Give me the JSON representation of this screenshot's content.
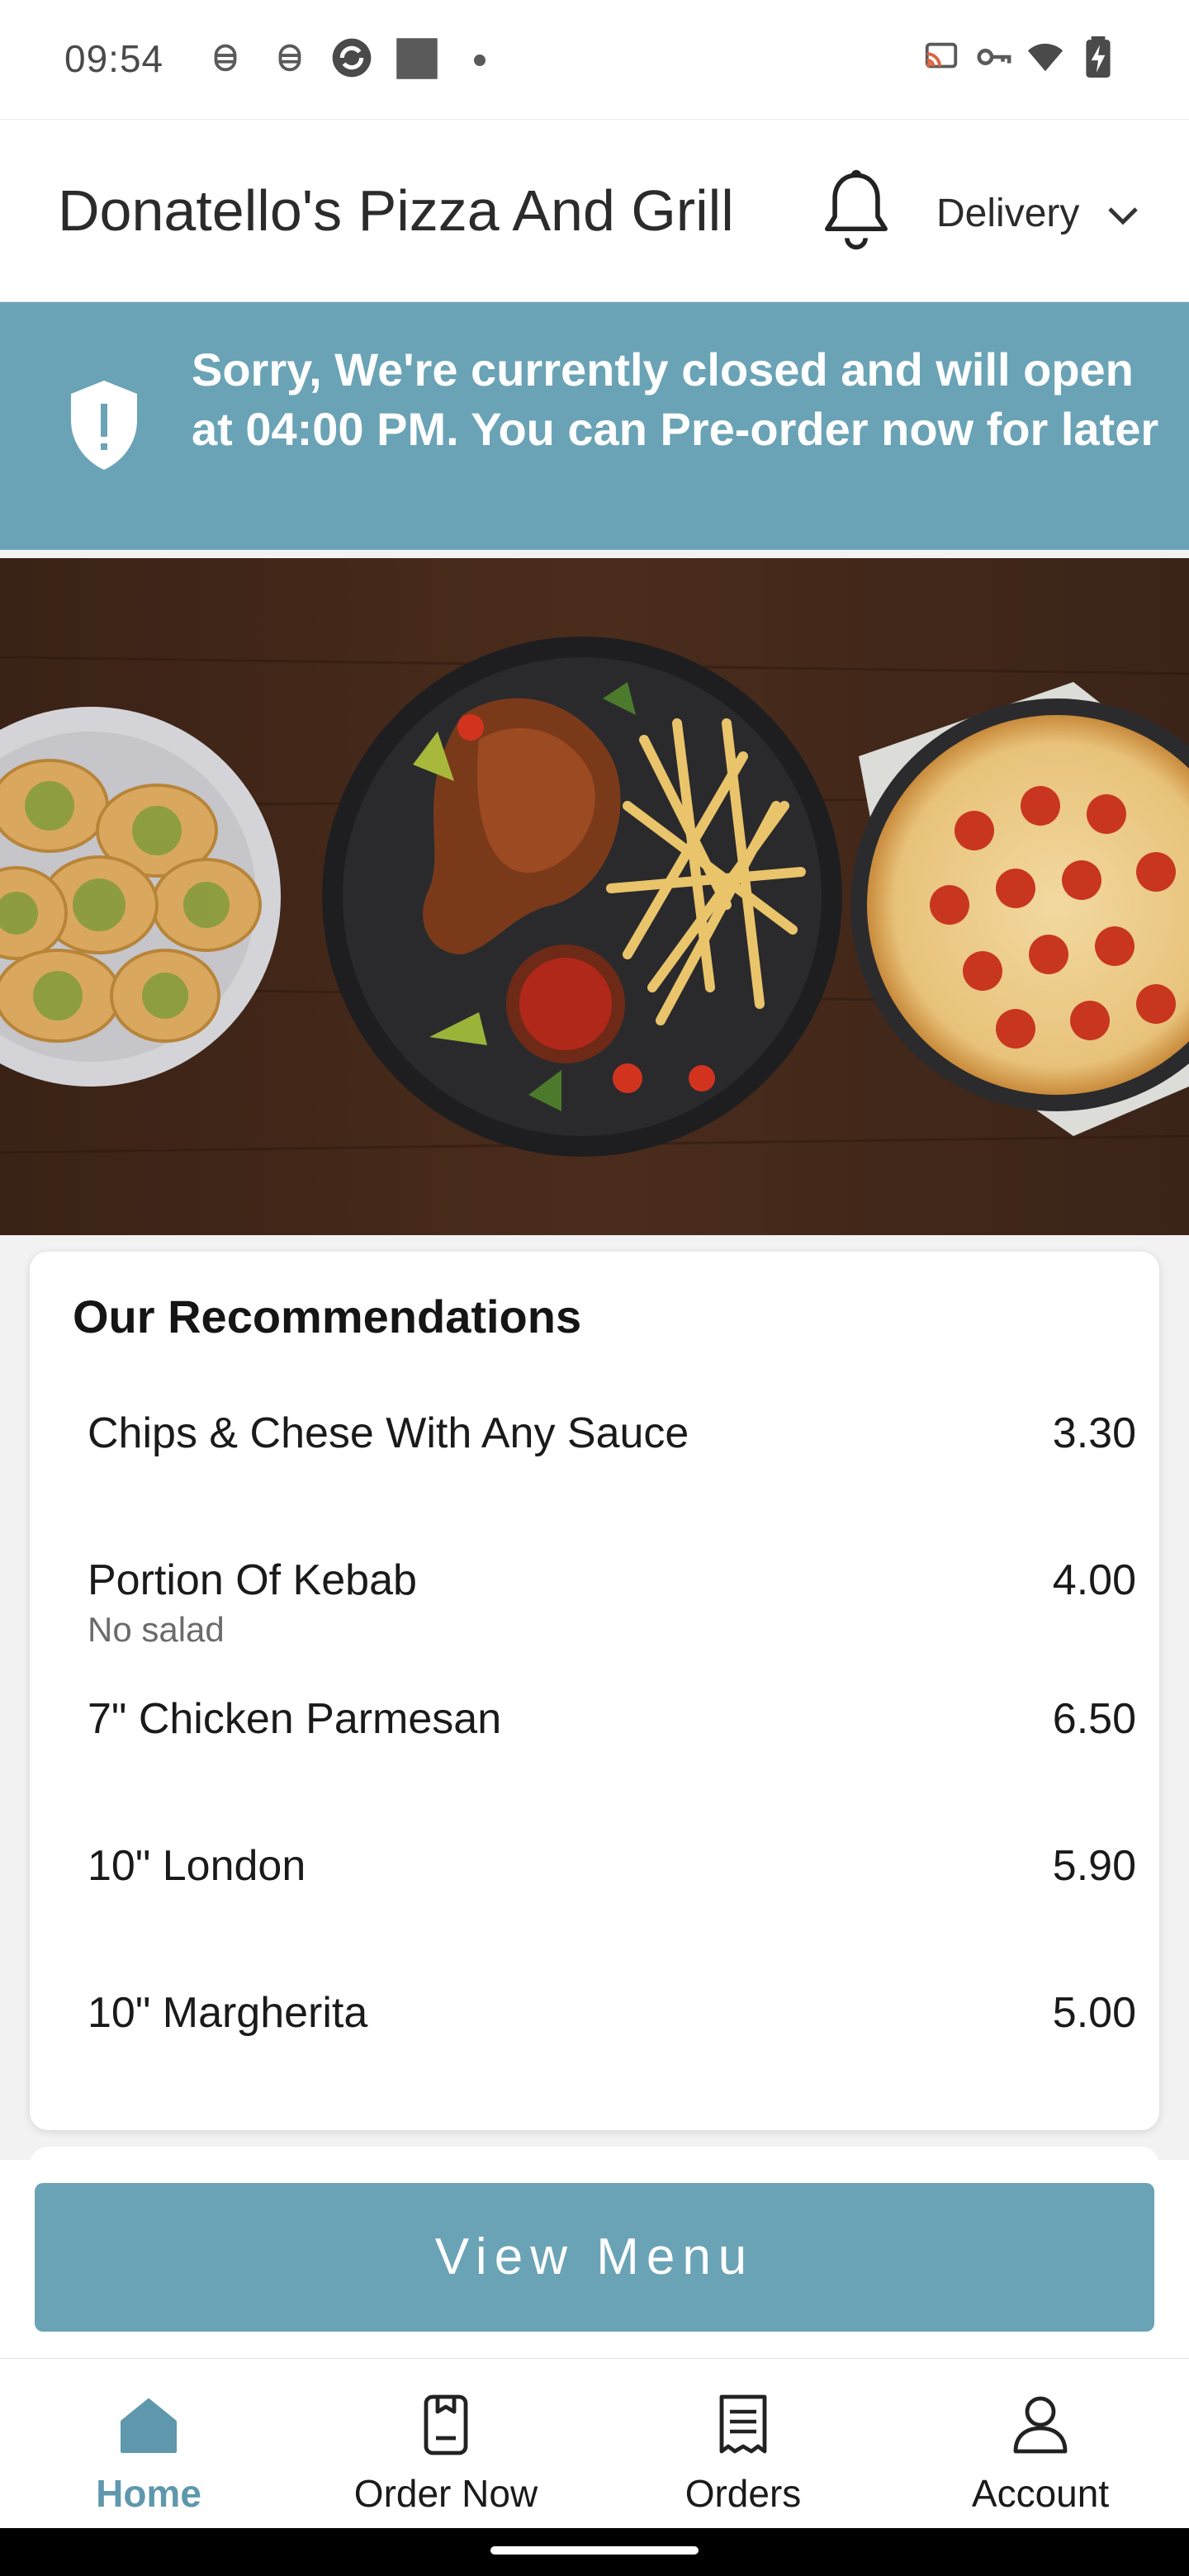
{
  "status_bar": {
    "time": "09:54",
    "left_icons": [
      "debug-icon",
      "debug-icon",
      "sync-icon",
      "square-icon",
      "dot-icon"
    ],
    "right_icons": [
      "cast-icon",
      "vpn-key-icon",
      "wifi-icon",
      "battery-charging-icon"
    ]
  },
  "header": {
    "store_name": "Donatello's Pizza And Grill",
    "notification_icon": "bell-icon",
    "order_mode": "Delivery"
  },
  "banner": {
    "icon": "shield-alert-icon",
    "message": "Sorry, We're currently closed and will open at 04:00 PM. You can Pre-order now for later"
  },
  "recommendations": {
    "title": "Our Recommendations",
    "items": [
      {
        "name": "Chips & Chese With Any Sauce",
        "subtitle": "",
        "price": "3.30"
      },
      {
        "name": "Portion Of Kebab",
        "subtitle": "No salad",
        "price": "4.00"
      },
      {
        "name": "7\" Chicken Parmesan",
        "subtitle": "",
        "price": "6.50"
      },
      {
        "name": "10\" London",
        "subtitle": "",
        "price": "5.90"
      },
      {
        "name": "10\" Margherita",
        "subtitle": "",
        "price": "5.00"
      }
    ]
  },
  "view_menu_label": "View Menu",
  "nav": {
    "items": [
      {
        "label": "Home",
        "icon": "home-icon",
        "active": true
      },
      {
        "label": "Order Now",
        "icon": "order-now-icon",
        "active": false
      },
      {
        "label": "Orders",
        "icon": "receipt-icon",
        "active": false
      },
      {
        "label": "Account",
        "icon": "user-icon",
        "active": false
      }
    ]
  },
  "colors": {
    "accent": "#6aa3b6",
    "active_nav": "#5f98ad",
    "banner_text": "#ffffff"
  }
}
